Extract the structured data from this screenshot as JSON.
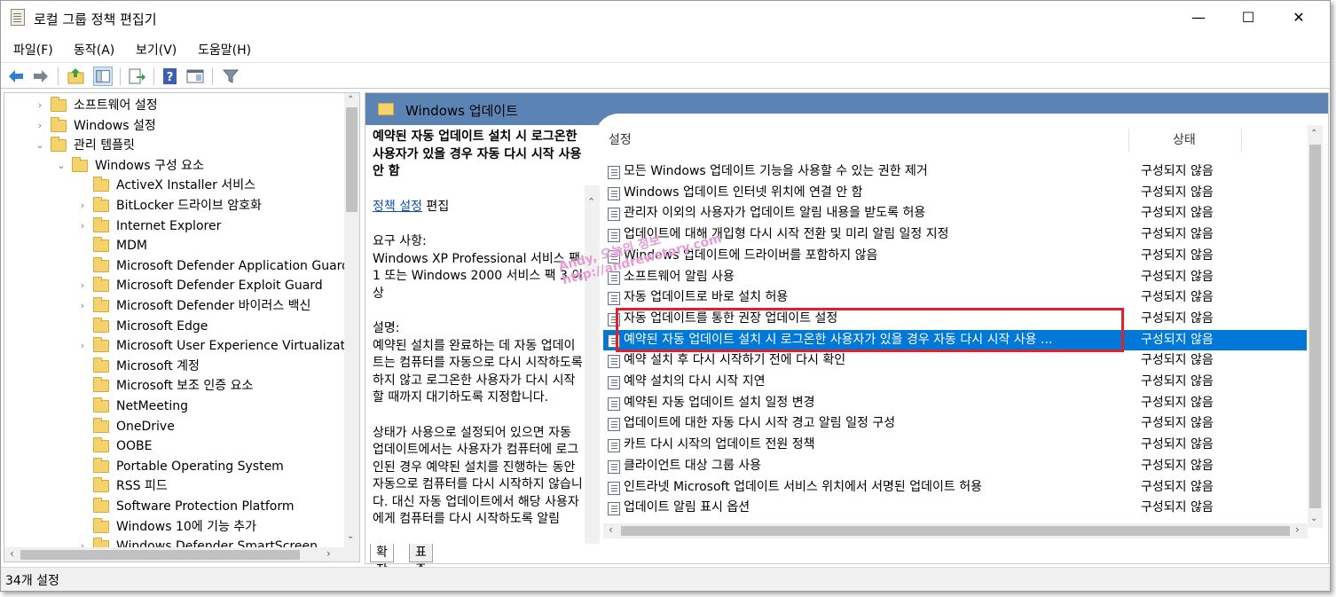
{
  "window": {
    "title": "로컬 그룹 정책 편집기",
    "minimize": "—",
    "maximize": "☐",
    "close": "✕"
  },
  "menu": [
    "파일(F)",
    "동작(A)",
    "보기(V)",
    "도움말(H)"
  ],
  "tree": [
    {
      "label": "소프트웨어 설정",
      "chevron": "›",
      "indent": 0
    },
    {
      "label": "Windows 설정",
      "chevron": "›",
      "indent": 0
    },
    {
      "label": "관리 템플릿",
      "chevron": "⌄",
      "indent": 0
    },
    {
      "label": "Windows 구성 요소",
      "chevron": "⌄",
      "indent": 1
    },
    {
      "label": "ActiveX Installer 서비스",
      "chevron": "",
      "indent": 2
    },
    {
      "label": "BitLocker 드라이브 암호화",
      "chevron": "›",
      "indent": 2
    },
    {
      "label": "Internet Explorer",
      "chevron": "›",
      "indent": 2
    },
    {
      "label": "MDM",
      "chevron": "",
      "indent": 2
    },
    {
      "label": "Microsoft Defender Application Guard",
      "chevron": "",
      "indent": 2
    },
    {
      "label": "Microsoft Defender Exploit Guard",
      "chevron": "›",
      "indent": 2
    },
    {
      "label": "Microsoft Defender 바이러스 백신",
      "chevron": "›",
      "indent": 2
    },
    {
      "label": "Microsoft Edge",
      "chevron": "",
      "indent": 2
    },
    {
      "label": "Microsoft User Experience Virtualization",
      "chevron": "›",
      "indent": 2
    },
    {
      "label": "Microsoft 계정",
      "chevron": "",
      "indent": 2
    },
    {
      "label": "Microsoft 보조 인증 요소",
      "chevron": "",
      "indent": 2
    },
    {
      "label": "NetMeeting",
      "chevron": "",
      "indent": 2
    },
    {
      "label": "OneDrive",
      "chevron": "",
      "indent": 2
    },
    {
      "label": "OOBE",
      "chevron": "",
      "indent": 2
    },
    {
      "label": "Portable Operating System",
      "chevron": "",
      "indent": 2
    },
    {
      "label": "RSS 피드",
      "chevron": "",
      "indent": 2
    },
    {
      "label": "Software Protection Platform",
      "chevron": "",
      "indent": 2
    },
    {
      "label": "Windows 10에 기능 추가",
      "chevron": "",
      "indent": 2
    },
    {
      "label": "Windows Defender SmartScreen",
      "chevron": "›",
      "indent": 2
    }
  ],
  "right": {
    "header": "Windows 업데이트",
    "desc_title": "예약된 자동 업데이트 설치 시 로그온한 사용자가 있을 경우 자동 다시 시작 사용 안 함",
    "policy_link": "정책 설정",
    "edit_text": " 편집",
    "requirements_label": "요구 사항:",
    "requirements": "Windows XP Professional 서비스 팩 1 또는 Windows 2000 서비스 팩 3 이상",
    "description_label": "설명:",
    "description": "예약된 설치를 완료하는 데 자동 업데이트는 컴퓨터를 자동으로 다시 시작하도록 하지 않고 로그온한 사용자가 다시 시작할 때까지 대기하도록 지정합니다.",
    "description2": "상태가 사용으로 설정되어 있으면 자동 업데이트에서는 사용자가 컴퓨터에 로그인된 경우 예약된 설치를 진행하는 동안 자동으로 컴퓨터를 다시 시작하지 않습니다. 대신 자동 업데이트에서 해당 사용자에게 컴퓨터를 다시 시작하도록 알림"
  },
  "columns": {
    "setting": "설정",
    "state": "상태"
  },
  "rows": [
    {
      "name": "모든 Windows 업데이트 기능을 사용할 수 있는 권한 제거",
      "state": "구성되지 않음"
    },
    {
      "name": "Windows 업데이트 인터넷 위치에 연결 안 함",
      "state": "구성되지 않음"
    },
    {
      "name": "관리자 이외의 사용자가 업데이트 알림 내용을 받도록 허용",
      "state": "구성되지 않음"
    },
    {
      "name": "업데이트에 대해 개입형 다시 시작 전환 및 미리 알림 일정 지정",
      "state": "구성되지 않음"
    },
    {
      "name": "Windows 업데이트에 드라이버를 포함하지 않음",
      "state": "구성되지 않음"
    },
    {
      "name": "소프트웨어 알림 사용",
      "state": "구성되지 않음"
    },
    {
      "name": "자동 업데이트로 바로 설치 허용",
      "state": "구성되지 않음"
    },
    {
      "name": "자동 업데이트를 통한 권장 업데이트 설정",
      "state": "구성되지 않음"
    },
    {
      "name": "예약된 자동 업데이트 설치 시 로그온한 사용자가 있을 경우 자동 다시 시작 사용 ...",
      "state": "구성되지 않음",
      "selected": true
    },
    {
      "name": "예약 설치 후 다시 시작하기 전에 다시 확인",
      "state": "구성되지 않음"
    },
    {
      "name": "예약 설치의 다시 시작 지연",
      "state": "구성되지 않음"
    },
    {
      "name": "예약된 자동 업데이트 설치 일정 변경",
      "state": "구성되지 않음"
    },
    {
      "name": "업데이트에 대한 자동 다시 시작 경고 알림 일정 구성",
      "state": "구성되지 않음"
    },
    {
      "name": "카트 다시 시작의 업데이트 전원 정책",
      "state": "구성되지 않음"
    },
    {
      "name": "클라이언트 대상 그룹 사용",
      "state": "구성되지 않음"
    },
    {
      "name": "인트라넷 Microsoft 업데이트 서비스 위치에서 서명된 업데이트 허용",
      "state": "구성되지 않음"
    },
    {
      "name": "업데이트 알림 표시 옵션",
      "state": "구성되지 않음"
    }
  ],
  "tabs": [
    "확장",
    "표준"
  ],
  "status": "34개 설정",
  "watermark": {
    "line1": "Andy, 오늘의 정보",
    "line2": "http://andrewstory.com"
  },
  "colors": {
    "selection": "#0078d7",
    "header": "#5b84b4",
    "highlight_box": "#e0202a"
  }
}
